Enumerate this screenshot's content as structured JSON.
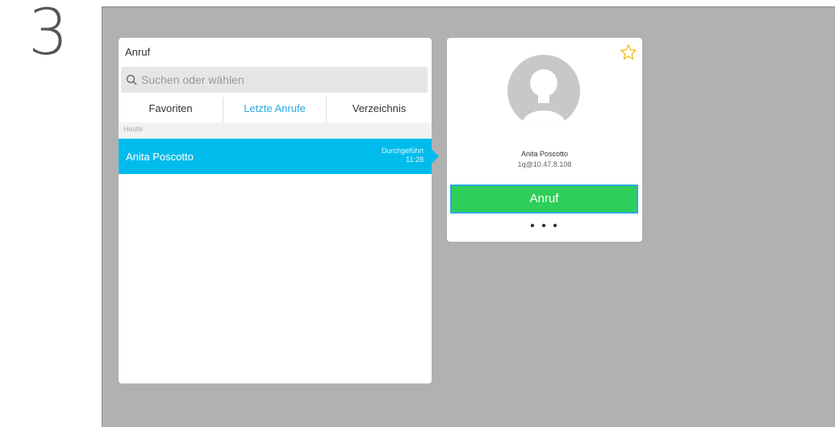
{
  "step_number": "3",
  "panel": {
    "title": "Anruf",
    "search": {
      "placeholder": "Suchen oder wählen"
    },
    "tabs": [
      {
        "label": "Favoriten",
        "active": false
      },
      {
        "label": "Letzte Anrufe",
        "active": true
      },
      {
        "label": "Verzeichnis",
        "active": false
      }
    ],
    "section_header": "Heute",
    "rows": [
      {
        "name": "Anita Poscotto",
        "status": "Durchgeführt",
        "time": "11:28"
      }
    ]
  },
  "detail": {
    "name": "Anita Poscotto",
    "uri": "1q@10.47.8.108",
    "call_label": "Anruf",
    "more_label": "• • •"
  },
  "colors": {
    "accent": "#27a9e1",
    "selected_row": "#00bcec",
    "call_button": "#2fce5a",
    "favorite_star": "#f0b400",
    "background": "#b1b1b1"
  },
  "icons": [
    "search-icon",
    "star-icon",
    "avatar-icon"
  ]
}
